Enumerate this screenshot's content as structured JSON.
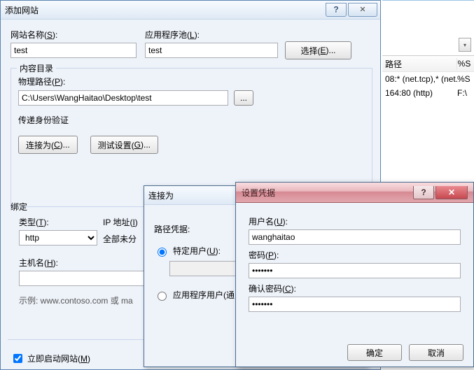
{
  "background": {
    "col_path_header": "路径",
    "col_perc_header": "%S",
    "row1_text": "08:* (net.tcp),* (net.",
    "row1_perc": "%S",
    "row2_text": "164:80 (http)",
    "row2_perc": "F:\\"
  },
  "add": {
    "title": "添加网站",
    "help_mark": "?",
    "close_mark": "✕",
    "site_name_label_pre": "网站名称(",
    "site_name_label_u": "S",
    "site_name_label_post": "):",
    "apppool_label_pre": "应用程序池(",
    "apppool_label_u": "L",
    "apppool_label_post": "):",
    "site_name_value": "test",
    "apppool_value": "test",
    "select_btn_pre": "选择(",
    "select_btn_u": "E",
    "select_btn_post": ")...",
    "content_legend": "内容目录",
    "phys_path_label_pre": "物理路径(",
    "phys_path_label_u": "P",
    "phys_path_label_post": "):",
    "phys_path_value": "C:\\Users\\WangHaitao\\Desktop\\test",
    "browse_btn": "...",
    "passthru_label": "传递身份验证",
    "connect_as_btn_pre": "连接为(",
    "connect_as_btn_u": "C",
    "connect_as_btn_post": ")...",
    "test_btn_pre": "测试设置(",
    "test_btn_u": "G",
    "test_btn_post": ")...",
    "binding_label": "绑定",
    "type_label_pre": "类型(",
    "type_label_u": "T",
    "type_label_post": "):",
    "ip_label_pre": "IP 地址(",
    "ip_label_u": "I",
    "ip_label_post": ")",
    "type_value": "http",
    "ip_text": "全部未分",
    "host_label_pre": "主机名(",
    "host_label_u": "H",
    "host_label_post": "):",
    "host_value": "",
    "example_text": "示例: www.contoso.com 或 ma",
    "autostart_label_pre": "立即启动网站(",
    "autostart_label_u": "M",
    "autostart_label_post": ")"
  },
  "conn": {
    "title": "连接为",
    "path_cred_label": "路径凭据:",
    "radio_specific_pre": "特定用户(",
    "radio_specific_u": "U",
    "radio_specific_post": "):",
    "specific_value": "",
    "radio_appuser_pre": "应用程序用户(通",
    "radio_appuser_u": "",
    "radio_appuser_post": ""
  },
  "cred": {
    "title": "设置凭据",
    "help_mark": "?",
    "close_mark": "✕",
    "user_label_pre": "用户名(",
    "user_label_u": "U",
    "user_label_post": "):",
    "user_value": "wanghaitao",
    "pass_label_pre": "密码(",
    "pass_label_u": "P",
    "pass_label_post": "):",
    "pass_value": "•••••••",
    "confirm_label_pre": "确认密码(",
    "confirm_label_u": "C",
    "confirm_label_post": "):",
    "confirm_value": "•••••••",
    "ok_btn": "确定",
    "cancel_btn": "取消"
  }
}
